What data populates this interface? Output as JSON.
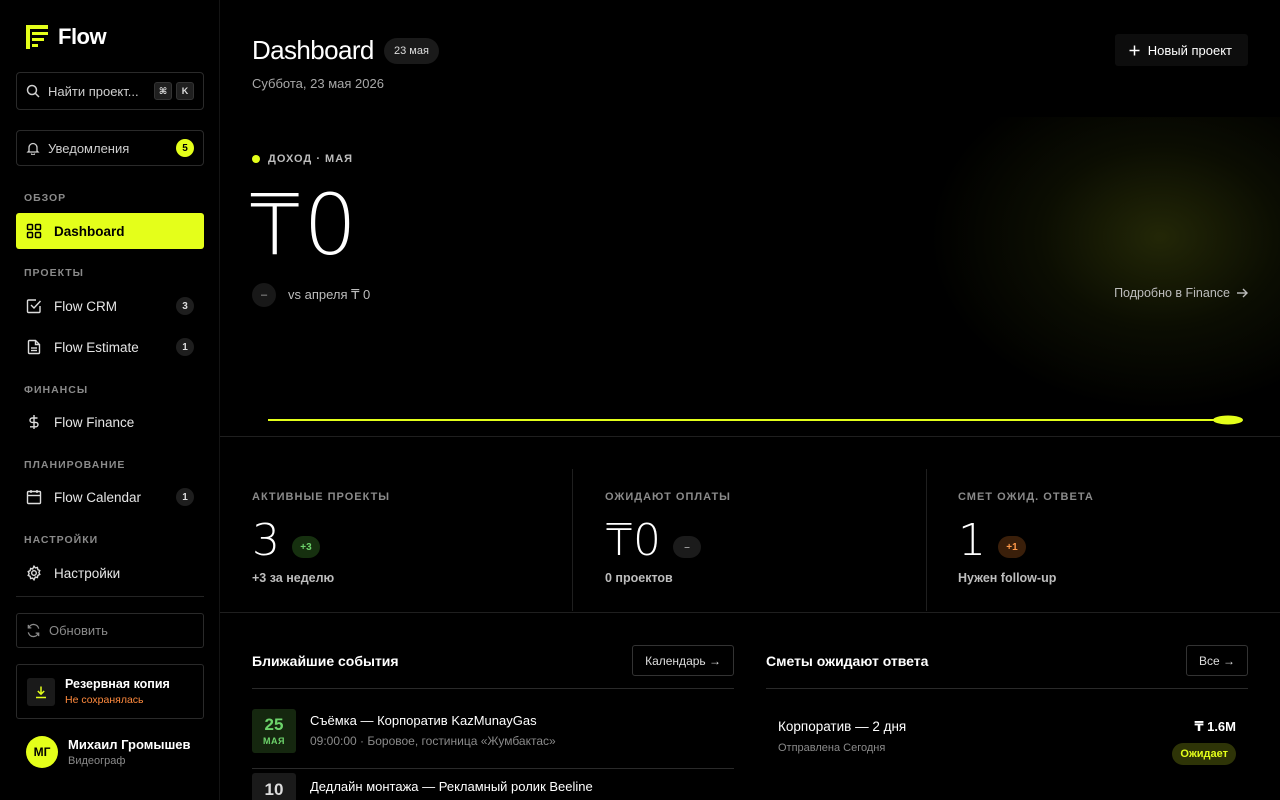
{
  "app": {
    "name": "Flow"
  },
  "sidebar": {
    "search": {
      "placeholder": "Найти проект...",
      "shortcut_mod": "⌘",
      "shortcut_key": "K"
    },
    "notifications": {
      "label": "Уведомления",
      "count": "5"
    },
    "sections": {
      "overview": "ОБЗОР",
      "projects": "ПРОЕКТЫ",
      "finance": "ФИНАНСЫ",
      "planning": "ПЛАНИРОВАНИЕ",
      "settings": "НАСТРОЙКИ"
    },
    "items": {
      "dashboard": {
        "label": "Dashboard",
        "icon": "grid-icon"
      },
      "crm": {
        "label": "Flow CRM",
        "count": "3",
        "icon": "checkbox-icon"
      },
      "estimate": {
        "label": "Flow Estimate",
        "count": "1",
        "icon": "document-icon"
      },
      "finance": {
        "label": "Flow Finance",
        "icon": "dollar-icon"
      },
      "calendar": {
        "label": "Flow Calendar",
        "count": "1",
        "icon": "calendar-icon"
      },
      "settings": {
        "label": "Настройки",
        "icon": "gear-icon"
      }
    },
    "refresh_label": "Обновить",
    "backup": {
      "title": "Резервная копия",
      "status": "Не сохранялась"
    },
    "user": {
      "initials": "МГ",
      "name": "Михаил Громышев",
      "role": "Видеограф"
    }
  },
  "header": {
    "title": "Dashboard",
    "date_chip": "23 мая",
    "subtitle": "Суббота, 23 мая 2026",
    "new_project_label": "Новый проект"
  },
  "revenue": {
    "label": "ДОХОД · МАЯ",
    "value": "₸0",
    "delta": "–",
    "compare": "vs апреля ₸ 0",
    "link": "Подробно в Finance"
  },
  "stats": [
    {
      "label": "АКТИВНЫЕ ПРОЕКТЫ",
      "value": "3",
      "pill": "+3",
      "sub": "+3 за неделю"
    },
    {
      "label": "ОЖИДАЮТ ОПЛАТЫ",
      "value": "₸0",
      "pill": "–",
      "sub": "0 проектов"
    },
    {
      "label": "СМЕТ ОЖИД. ОТВЕТА",
      "value": "1",
      "pill": "+1",
      "sub": "Нужен follow-up"
    }
  ],
  "events": {
    "title": "Ближайшие события",
    "button": "Календарь →",
    "items": [
      {
        "day": "25",
        "month": "МАЯ",
        "title": "Съёмка — Корпоратив KazMunayGas",
        "meta": "09:00:00 · Боровое, гостиница «Жумбактас»"
      },
      {
        "day": "10",
        "month": "",
        "title": "Дедлайн монтажа — Рекламный ролик Beeline",
        "meta": ""
      }
    ]
  },
  "estimates": {
    "title": "Сметы ожидают ответа",
    "button": "Все →",
    "items": [
      {
        "title": "Корпоратив — 2 дня",
        "sub": "Отправлена Сегодня",
        "amount": "₸ 1.6M",
        "status": "Ожидает"
      }
    ]
  },
  "colors": {
    "accent": "#e4ff1a",
    "background": "#000000",
    "warning": "#ff8a3d"
  }
}
